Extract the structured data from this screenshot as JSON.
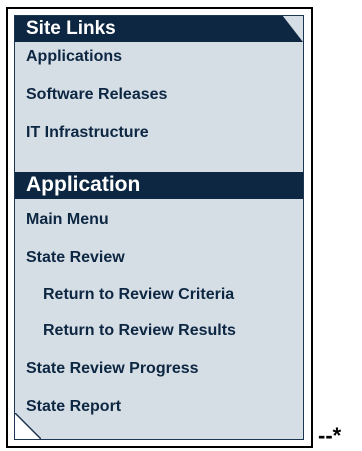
{
  "site_links": {
    "title": "Site Links",
    "items": [
      {
        "label": "Applications"
      },
      {
        "label": "Software Releases"
      },
      {
        "label": "IT Infrastructure"
      }
    ]
  },
  "application": {
    "title": "Application",
    "items": [
      {
        "label": "Main Menu"
      },
      {
        "label": "State Review"
      },
      {
        "label": "Return to Review Criteria"
      },
      {
        "label": "Return to Review Results"
      },
      {
        "label": "State Review Progress"
      },
      {
        "label": "State Report"
      }
    ]
  },
  "marker": "--*"
}
